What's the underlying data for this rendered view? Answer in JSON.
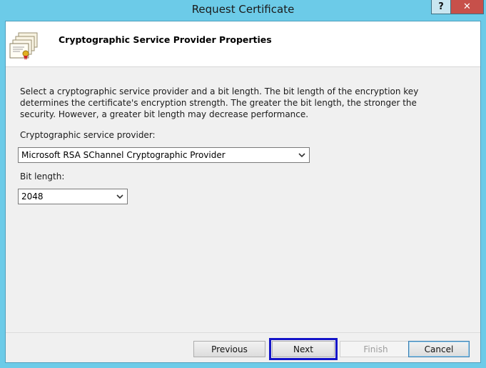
{
  "window": {
    "title": "Request Certificate",
    "help_glyph": "?",
    "close_glyph": "✕"
  },
  "header": {
    "title": "Cryptographic Service Provider Properties",
    "icon": "certificate-icon"
  },
  "body": {
    "description": "Select a cryptographic service provider and a bit length. The bit length of the encryption key determines the certificate's encryption strength. The greater the bit length, the stronger the security. However, a greater bit length may decrease performance.",
    "provider_label": "Cryptographic service provider:",
    "provider_value": "Microsoft RSA SChannel Cryptographic Provider",
    "bitlength_label": "Bit length:",
    "bitlength_value": "2048"
  },
  "buttons": {
    "previous": "Previous",
    "next": "Next",
    "finish": "Finish",
    "cancel": "Cancel"
  },
  "colors": {
    "frame": "#6ccbe8",
    "close": "#c7504a",
    "focus_highlight": "#1414c8"
  }
}
